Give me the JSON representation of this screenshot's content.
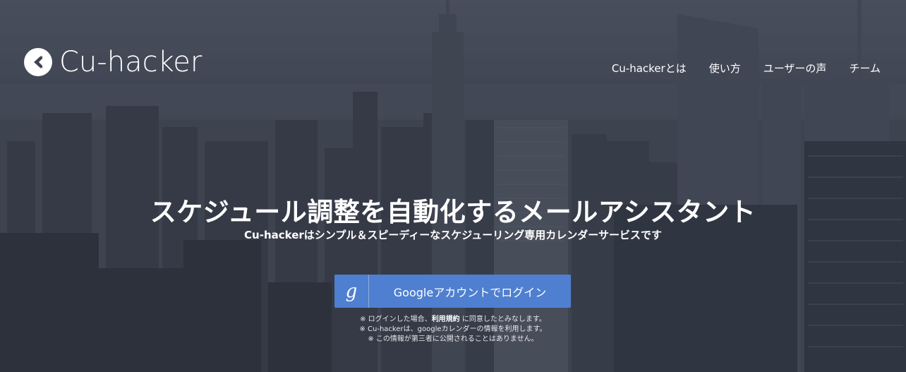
{
  "brand": {
    "logo_text": "Cu-hacker",
    "logo_icon": "cu-hacker-logo-icon"
  },
  "nav": {
    "items": [
      {
        "label": "Cu-hackerとは"
      },
      {
        "label": "使い方"
      },
      {
        "label": "ユーザーの声"
      },
      {
        "label": "チーム"
      }
    ]
  },
  "hero": {
    "headline": "スケジュール調整を自動化するメールアシスタント",
    "subline": "Cu-hackerはシンプル＆スピーディーなスケジューリング専用カレンダーサービスです",
    "login_button": {
      "icon_glyph": "g",
      "icon": "google-g-icon",
      "label": "Googleアカウントでログイン",
      "color": "#4f7fd0"
    },
    "notes": {
      "line1_prefix": "※ ログインした場合、",
      "line1_link": "利用規約",
      "line1_suffix": " に同意したとみなします。",
      "line2": "※ Cu-hackerは、googleカレンダーの情報を利用します。",
      "line3": "※ この情報が第三者に公開されることはありません。"
    }
  },
  "colors": {
    "background_overlay": "#3b404d",
    "text": "#ffffff"
  }
}
